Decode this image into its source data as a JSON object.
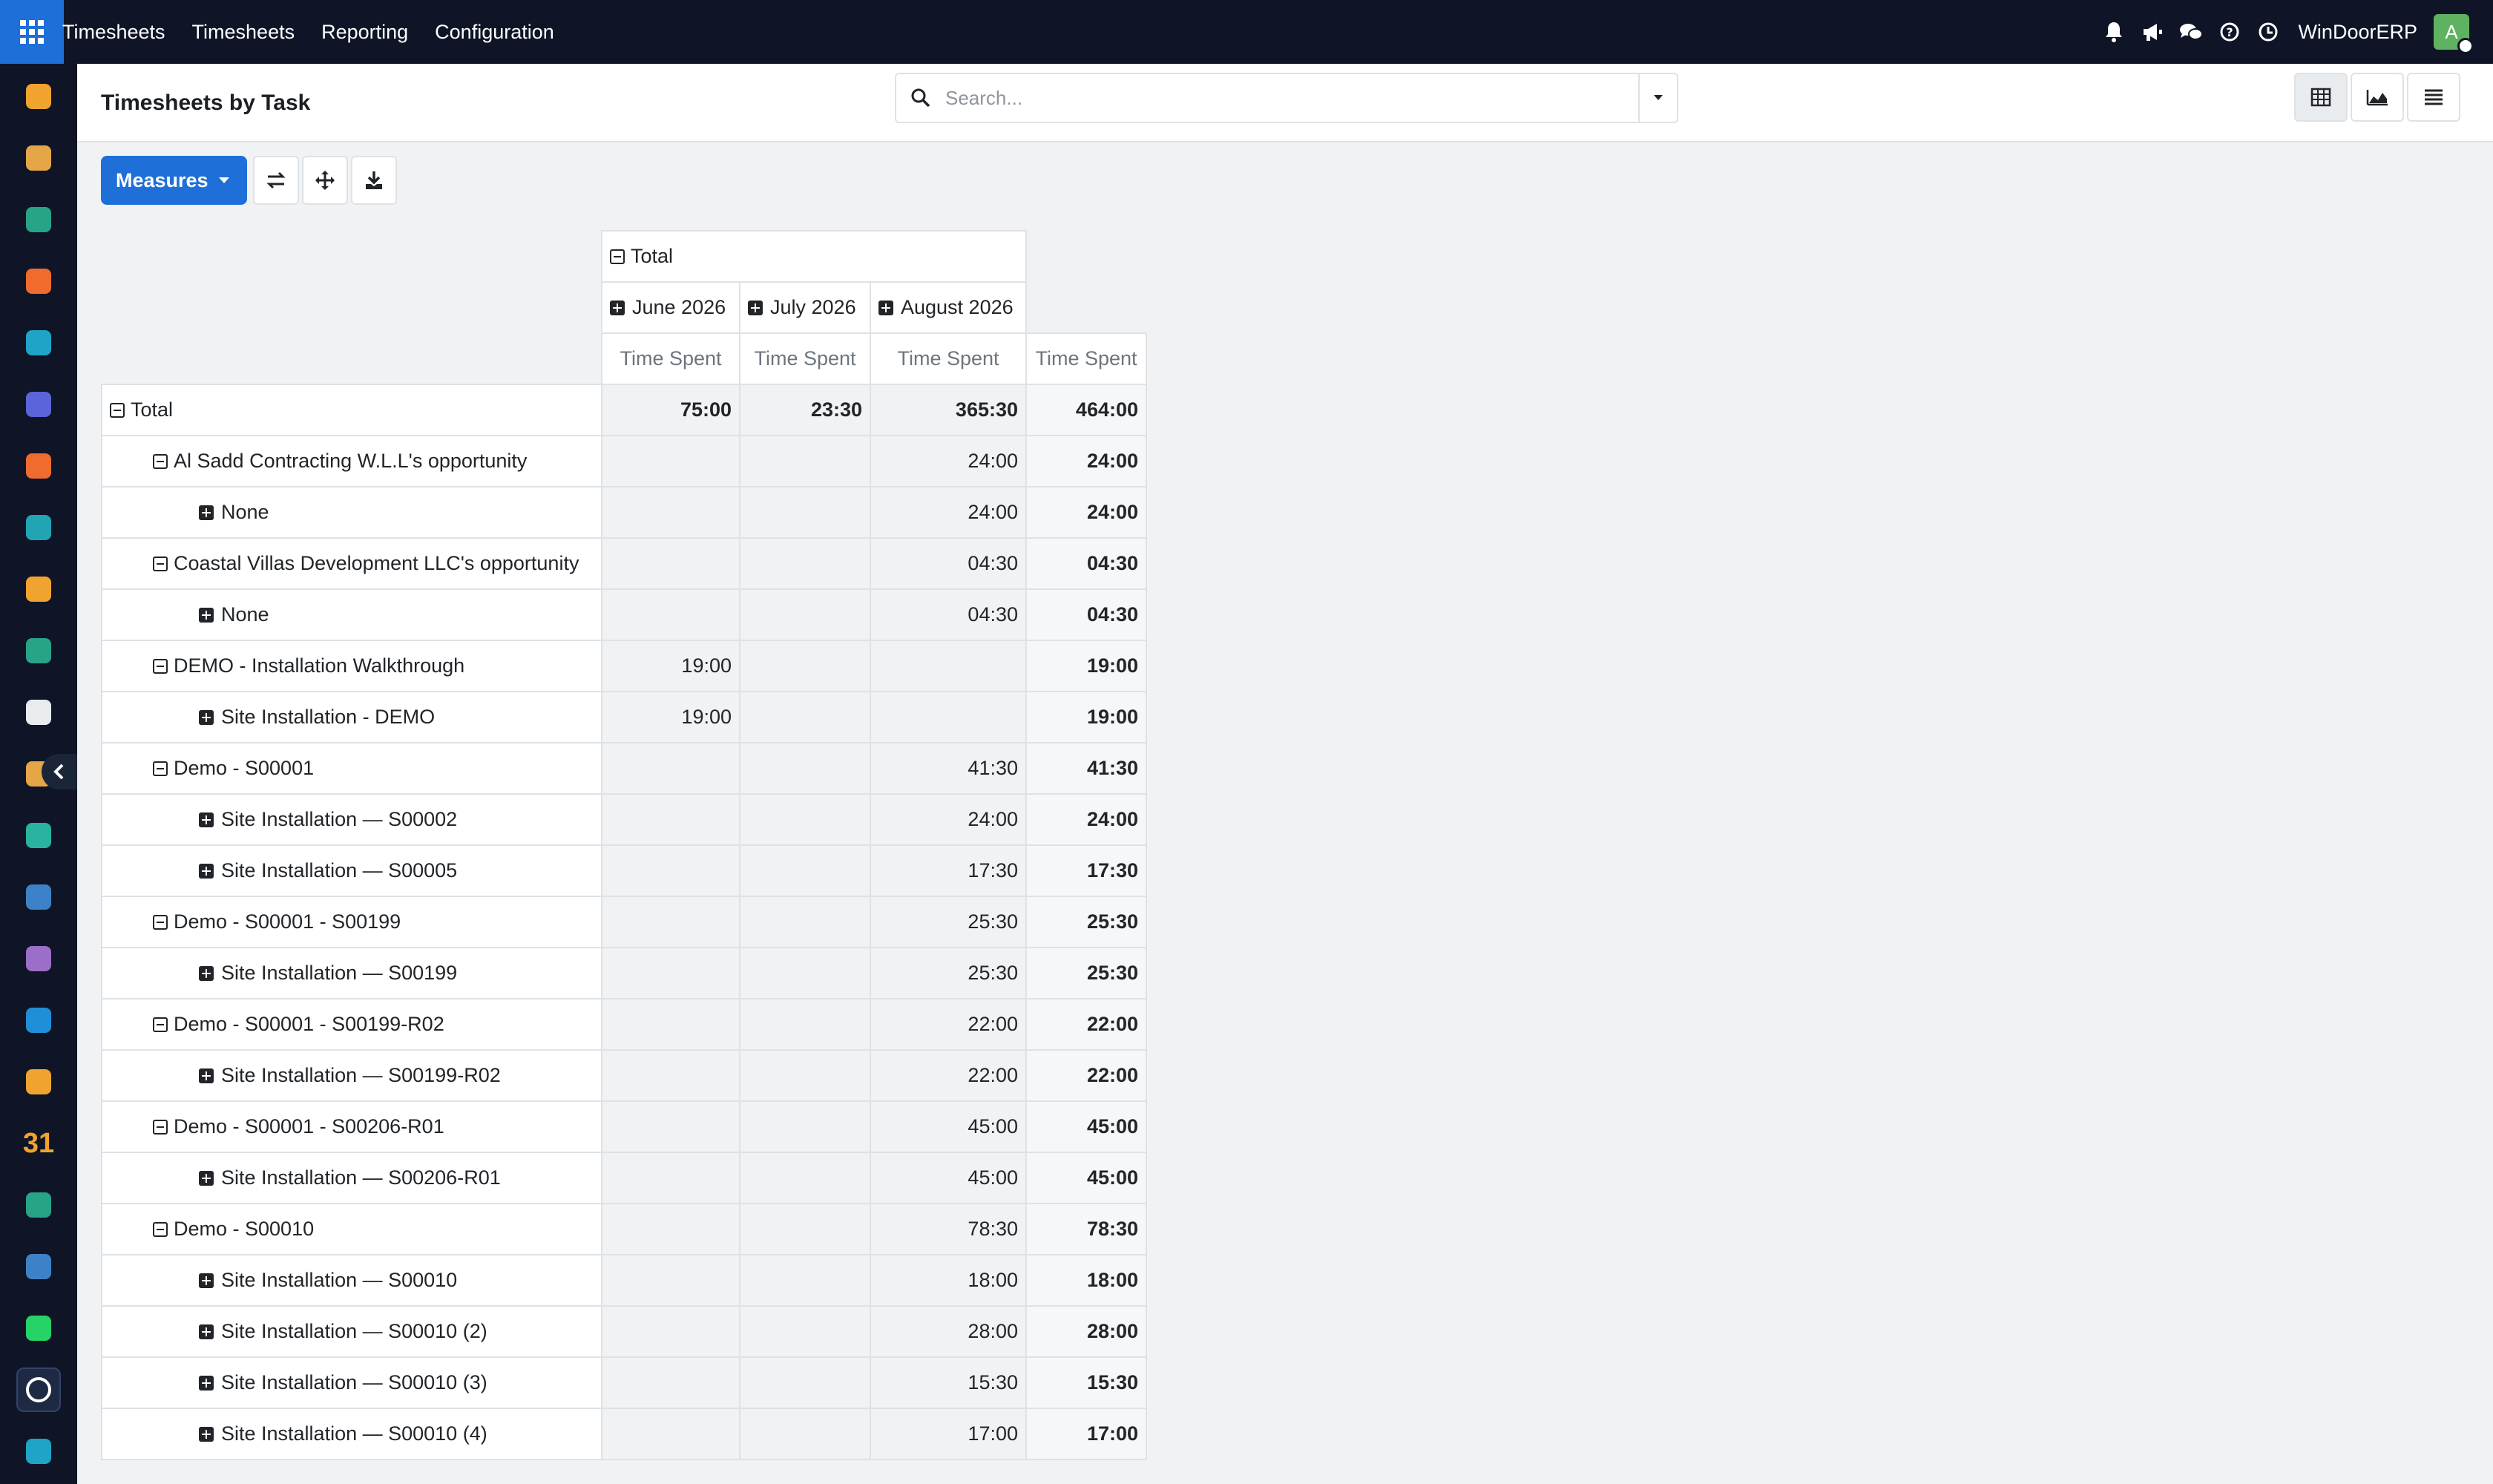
{
  "nav": {
    "brand": "Timesheets",
    "menus": [
      "Timesheets",
      "Reporting",
      "Configuration"
    ],
    "company": "WinDoorERP",
    "avatar_initial": "A",
    "icons": [
      "bell-icon",
      "megaphone-icon",
      "chat-icon",
      "help-icon",
      "clock-icon"
    ]
  },
  "sidebar": {
    "apps": [
      {
        "name": "sidebar-app-sales",
        "color": "#f0a32e"
      },
      {
        "name": "sidebar-app-inventory",
        "color": "#e5a647"
      },
      {
        "name": "sidebar-app-contacts",
        "color": "#27a386"
      },
      {
        "name": "sidebar-app-discuss",
        "color": "#f06b2e"
      },
      {
        "name": "sidebar-app-website",
        "color": "#1fa4c7"
      },
      {
        "name": "sidebar-app-email",
        "color": "#5b64d8"
      },
      {
        "name": "sidebar-app-live-chat",
        "color": "#f06b2e"
      },
      {
        "name": "sidebar-app-crm",
        "color": "#21a5b3"
      },
      {
        "name": "sidebar-app-reporting",
        "color": "#f0a32e"
      },
      {
        "name": "sidebar-app-employees",
        "color": "#27a386"
      },
      {
        "name": "sidebar-app-products",
        "color": "#e9ecef"
      },
      {
        "name": "sidebar-app-purchase",
        "color": "#e5a647"
      },
      {
        "name": "sidebar-app-project",
        "color": "#27b3a0"
      },
      {
        "name": "sidebar-app-knowledge",
        "color": "#3d82c9"
      },
      {
        "name": "sidebar-app-manufacturing",
        "color": "#9b6ec8"
      },
      {
        "name": "sidebar-app-accounting",
        "color": "#1f8fd8"
      },
      {
        "name": "sidebar-app-team",
        "color": "#f0a32e"
      },
      {
        "name": "sidebar-app-calendar",
        "color": "#f0a32e",
        "label": "31"
      },
      {
        "name": "sidebar-app-sign",
        "color": "#27a386"
      },
      {
        "name": "sidebar-app-dashboards",
        "color": "#3d82c9"
      },
      {
        "name": "sidebar-app-whatsapp",
        "color": "#25d366"
      },
      {
        "name": "sidebar-app-timesheets",
        "color": "#1f6fd8",
        "active": true
      },
      {
        "name": "sidebar-app-helpdesk",
        "color": "#1fa4c7"
      }
    ]
  },
  "control": {
    "title": "Timesheets by Task",
    "search_placeholder": "Search..."
  },
  "toolbar": {
    "measures_label": "Measures"
  },
  "pivot": {
    "col_total": "Total",
    "months": [
      "June 2026",
      "July 2026",
      "August 2026"
    ],
    "measure": "Time Spent",
    "rows": [
      {
        "label": "Total",
        "level": 0,
        "icon": "minus",
        "values": [
          "75:00",
          "23:30",
          "365:30",
          "464:00"
        ]
      },
      {
        "label": "Al Sadd Contracting W.L.L's opportunity",
        "level": 1,
        "icon": "minus",
        "values": [
          "",
          "",
          "24:00",
          "24:00"
        ]
      },
      {
        "label": "None",
        "level": 2,
        "icon": "plus",
        "values": [
          "",
          "",
          "24:00",
          "24:00"
        ]
      },
      {
        "label": "Coastal Villas Development LLC's opportunity",
        "level": 1,
        "icon": "minus",
        "values": [
          "",
          "",
          "04:30",
          "04:30"
        ]
      },
      {
        "label": "None",
        "level": 2,
        "icon": "plus",
        "values": [
          "",
          "",
          "04:30",
          "04:30"
        ]
      },
      {
        "label": "DEMO - Installation Walkthrough",
        "level": 1,
        "icon": "minus",
        "values": [
          "19:00",
          "",
          "",
          "19:00"
        ]
      },
      {
        "label": "Site Installation - DEMO",
        "level": 2,
        "icon": "plus",
        "values": [
          "19:00",
          "",
          "",
          "19:00"
        ]
      },
      {
        "label": "Demo - S00001",
        "level": 1,
        "icon": "minus",
        "values": [
          "",
          "",
          "41:30",
          "41:30"
        ]
      },
      {
        "label": "Site Installation — S00002",
        "level": 2,
        "icon": "plus",
        "values": [
          "",
          "",
          "24:00",
          "24:00"
        ]
      },
      {
        "label": "Site Installation — S00005",
        "level": 2,
        "icon": "plus",
        "values": [
          "",
          "",
          "17:30",
          "17:30"
        ]
      },
      {
        "label": "Demo - S00001 - S00199",
        "level": 1,
        "icon": "minus",
        "values": [
          "",
          "",
          "25:30",
          "25:30"
        ]
      },
      {
        "label": "Site Installation — S00199",
        "level": 2,
        "icon": "plus",
        "values": [
          "",
          "",
          "25:30",
          "25:30"
        ]
      },
      {
        "label": "Demo - S00001 - S00199-R02",
        "level": 1,
        "icon": "minus",
        "values": [
          "",
          "",
          "22:00",
          "22:00"
        ]
      },
      {
        "label": "Site Installation — S00199-R02",
        "level": 2,
        "icon": "plus",
        "values": [
          "",
          "",
          "22:00",
          "22:00"
        ]
      },
      {
        "label": "Demo - S00001 - S00206-R01",
        "level": 1,
        "icon": "minus",
        "values": [
          "",
          "",
          "45:00",
          "45:00"
        ]
      },
      {
        "label": "Site Installation — S00206-R01",
        "level": 2,
        "icon": "plus",
        "values": [
          "",
          "",
          "45:00",
          "45:00"
        ]
      },
      {
        "label": "Demo - S00010",
        "level": 1,
        "icon": "minus",
        "values": [
          "",
          "",
          "78:30",
          "78:30"
        ]
      },
      {
        "label": "Site Installation — S00010",
        "level": 2,
        "icon": "plus",
        "values": [
          "",
          "",
          "18:00",
          "18:00"
        ]
      },
      {
        "label": "Site Installation — S00010 (2)",
        "level": 2,
        "icon": "plus",
        "values": [
          "",
          "",
          "28:00",
          "28:00"
        ]
      },
      {
        "label": "Site Installation — S00010 (3)",
        "level": 2,
        "icon": "plus",
        "values": [
          "",
          "",
          "15:30",
          "15:30"
        ]
      },
      {
        "label": "Site Installation — S00010 (4)",
        "level": 2,
        "icon": "plus",
        "values": [
          "",
          "",
          "17:00",
          "17:00"
        ]
      }
    ]
  }
}
